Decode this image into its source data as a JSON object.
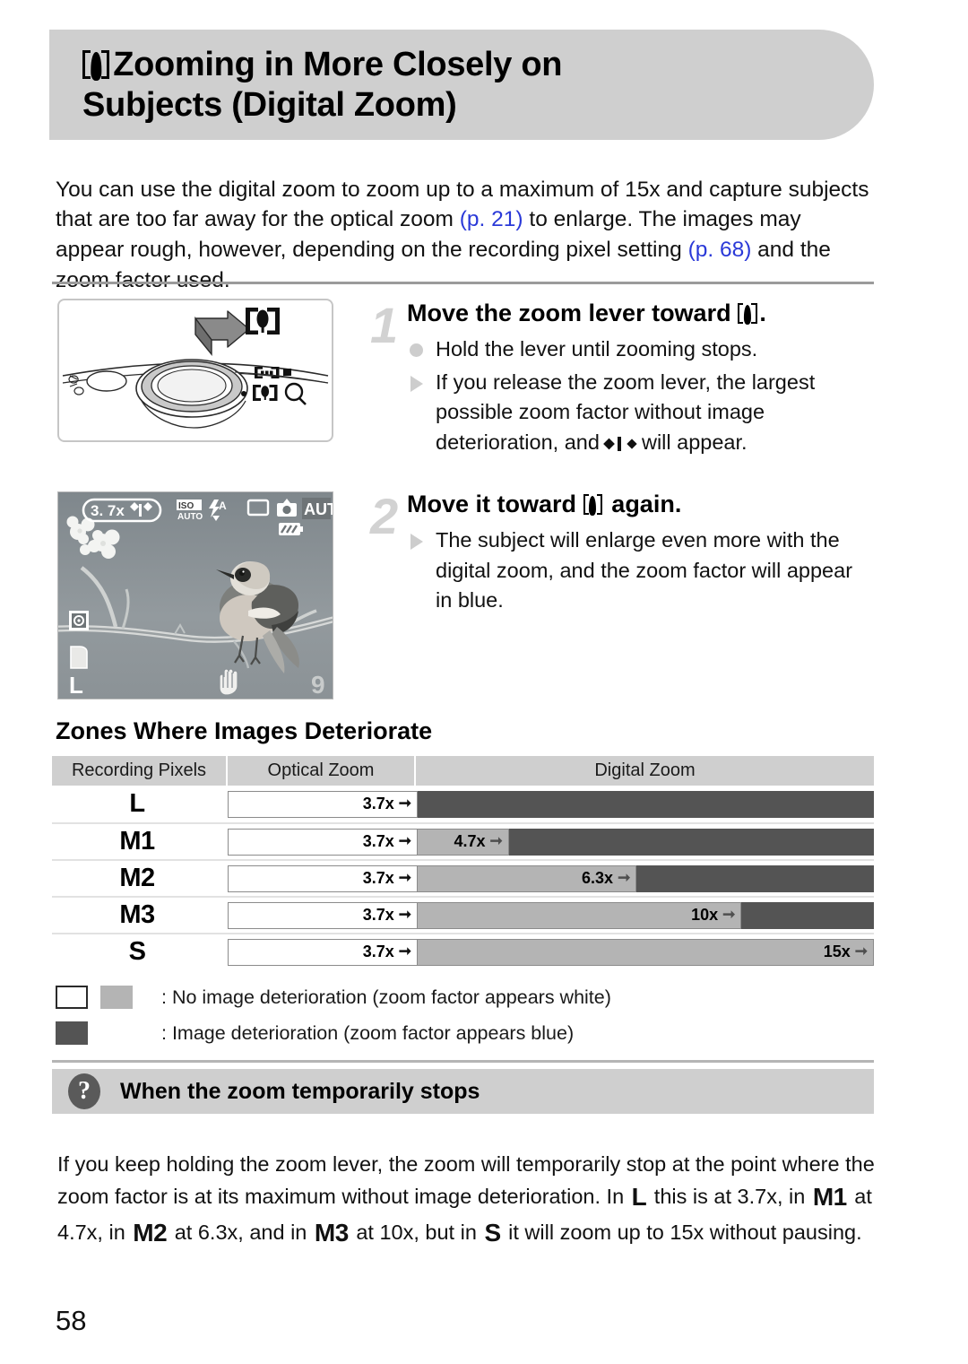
{
  "header": {
    "icon": "telephoto-tree-icon",
    "title_line1": "Zooming in More Closely on",
    "title_line2": "Subjects (Digital Zoom)"
  },
  "intro": {
    "seg1": "You can use the digital zoom to zoom up to a maximum of 15x and capture subjects that are too far away for the optical zoom ",
    "xref1": "(p. 21)",
    "seg2": " to enlarge. The images may appear rough, however, depending on the recording pixel setting ",
    "xref2": "(p. 68)",
    "seg3": " and the zoom factor used."
  },
  "figures": {
    "camera": {
      "name": "camera-zoom-lever-illustration",
      "tele_label": "[tree]",
      "wide_label": "[W]",
      "magnifier_label": "magnifier"
    },
    "lcd": {
      "name": "camera-lcd-preview",
      "zoom_factor": "3. 7x",
      "iso_label": "ISO",
      "iso_value": "AUTO",
      "flash_label": "A",
      "mode_label": "AUTO",
      "recording_pixels": "L",
      "shots_remaining": "9"
    }
  },
  "steps": [
    {
      "number": "1",
      "title_pre": "Move the zoom lever toward ",
      "title_post": ".",
      "bullets": [
        {
          "marker": "dot",
          "text": "Hold the lever until zooming stops."
        },
        {
          "marker": "triangle",
          "text_pre": "If you release the zoom lever, the largest possible zoom factor without image deterioration, and ",
          "text_post": " will appear."
        }
      ]
    },
    {
      "number": "2",
      "title_pre": "Move it toward ",
      "title_post": " again.",
      "bullets": [
        {
          "marker": "triangle",
          "text": "The subject will enlarge even more with the digital zoom, and the zoom factor will appear in blue."
        }
      ]
    }
  ],
  "zones": {
    "title": "Zones Where Images Deteriorate",
    "columns": [
      "Recording Pixels",
      "Optical Zoom",
      "Digital Zoom"
    ],
    "rows": [
      {
        "label": "L",
        "optical": "3.7x",
        "gray": null,
        "gray_pct": 0,
        "dark": true
      },
      {
        "label": "M1",
        "optical": "3.7x",
        "gray": "4.7x",
        "gray_pct": 20,
        "dark": true
      },
      {
        "label": "M2",
        "optical": "3.7x",
        "gray": "6.3x",
        "gray_pct": 48,
        "dark": true
      },
      {
        "label": "M3",
        "optical": "3.7x",
        "gray": "10x",
        "gray_pct": 71,
        "dark": true
      },
      {
        "label": "S",
        "optical": "3.7x",
        "gray": "15x",
        "gray_pct": 100,
        "dark": false
      }
    ]
  },
  "legend": [
    {
      "swatches": [
        "white",
        "gray"
      ],
      "text": ": No image deterioration (zoom factor appears white)"
    },
    {
      "swatches": [
        "dark"
      ],
      "text": ": Image deterioration (zoom factor appears blue)"
    }
  ],
  "tip": {
    "icon": "question-mark-icon",
    "icon_glyph": "?",
    "title": "When the zoom temporarily stops",
    "body_1": "If you keep holding the zoom lever, the zoom will temporarily stop at the point where the zoom factor is at its maximum without image deterioration. In ",
    "px_L": "L",
    "body_2": " this is at 3.7x, in ",
    "px_M1": "M1",
    "body_3": " at 4.7x, in ",
    "px_M2": "M2",
    "body_4": " at 6.3x, and in ",
    "px_M3": "M3",
    "body_5": " at 10x, but in ",
    "px_S": "S",
    "body_6": " it will zoom up to 15x without pausing."
  },
  "page_number": "58",
  "colors": {
    "header_gray": "#cfcfcf",
    "bar_dark": "#545454",
    "bar_gray": "#b4b4b4",
    "xref_blue": "#2a39d8"
  }
}
